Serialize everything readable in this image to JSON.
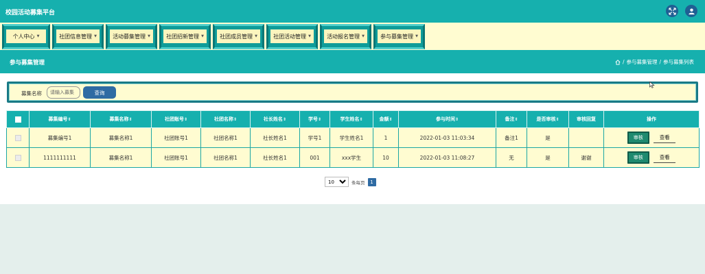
{
  "app": {
    "title": "校园活动募集平台"
  },
  "topbar": {
    "icons": [
      "fullscreen-icon",
      "user-icon"
    ],
    "accent": "#16b0ae",
    "icon_bg": "#1f5f93"
  },
  "menu": {
    "items": [
      {
        "label": "个人中心"
      },
      {
        "label": "社团信息管理"
      },
      {
        "label": "活动募集管理"
      },
      {
        "label": "社团招新管理"
      },
      {
        "label": "社团成员管理"
      },
      {
        "label": "社团活动管理"
      },
      {
        "label": "活动报名管理"
      },
      {
        "label": "参与募集管理"
      }
    ]
  },
  "page": {
    "title": "参与募集管理",
    "breadcrumb": [
      "参与募集管理",
      "参与募集列表"
    ],
    "breadcrumb_sep": "/"
  },
  "search": {
    "label": "募集名称",
    "placeholder": "请输入募集",
    "value": "",
    "button": "查询"
  },
  "table": {
    "columns": [
      "募集编号",
      "募集名称",
      "社团账号",
      "社团名称",
      "社长姓名",
      "学号",
      "学生姓名",
      "金额",
      "参与时间",
      "备注",
      "是否审核",
      "审核回复",
      "操作"
    ],
    "sort_glyph": "⇕",
    "rows": [
      {
        "cells": [
          "募集编号1",
          "募集名称1",
          "社团账号1",
          "社团名称1",
          "社长姓名1",
          "学号1",
          "学生姓名1",
          "1",
          "2022-01-03 11:03:34",
          "备注1",
          "是",
          ""
        ]
      },
      {
        "cells": [
          "1111111111",
          "募集名称1",
          "社团账号1",
          "社团名称1",
          "社长姓名1",
          "001",
          "xxx学生",
          "10",
          "2022-01-03 11:08:27",
          "无",
          "是",
          "谢谢"
        ]
      }
    ],
    "actions": {
      "audit": "审核",
      "view": "查看"
    }
  },
  "pager": {
    "page_size": "10",
    "page_size_options": [
      "10"
    ],
    "per_page_label": "条每页",
    "current_page": "1"
  },
  "colors": {
    "teal": "#16b0ae",
    "cream": "#fffcd1",
    "button_blue": "#2f6ba3",
    "audit_green": "#1f8a6f"
  }
}
